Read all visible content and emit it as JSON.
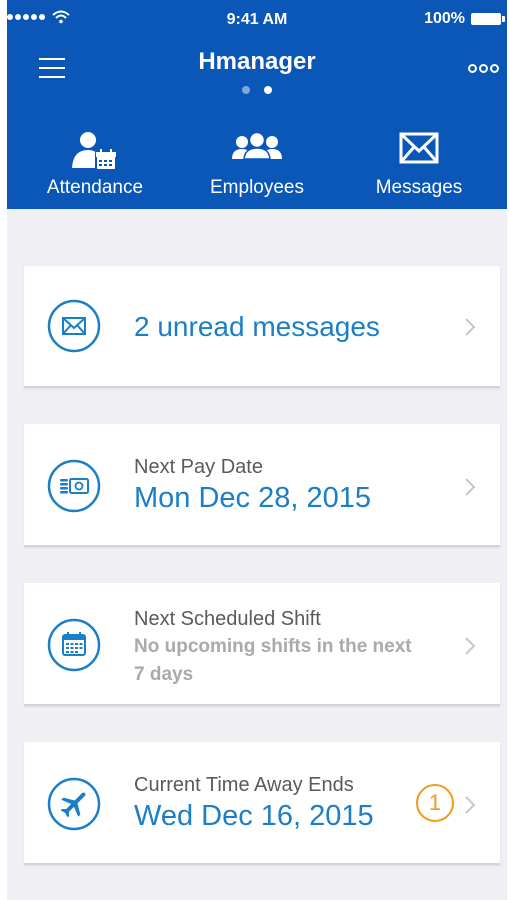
{
  "status_bar": {
    "time": "9:41 AM",
    "battery": "100%",
    "signal_icon": "signal-dots-icon",
    "wifi_icon": "wifi-icon"
  },
  "header": {
    "title": "Hmanager",
    "menu_icon": "hamburger-menu-icon",
    "more_icon": "more-options-icon",
    "page_indicator": {
      "pages": 2,
      "active": 2
    }
  },
  "nav": [
    {
      "label": "Attendance",
      "icon": "attendance-icon"
    },
    {
      "label": "Employees",
      "icon": "employees-icon"
    },
    {
      "label": "Messages",
      "icon": "envelope-icon"
    }
  ],
  "cards": {
    "messages": {
      "text": "2 unread messages",
      "icon": "envelope-icon"
    },
    "pay": {
      "label": "Next Pay Date",
      "value": "Mon Dec 28, 2015",
      "icon": "money-icon"
    },
    "shift": {
      "label": "Next Scheduled Shift",
      "value": "No upcoming shifts in the next 7 days",
      "icon": "calendar-icon"
    },
    "time_away": {
      "label": "Current Time Away Ends",
      "value": "Wed Dec 16, 2015",
      "badge": "1",
      "icon": "airplane-icon"
    }
  },
  "colors": {
    "header_bg": "#0a57b8",
    "accent": "#1a7fc7",
    "badge": "#f39a1a",
    "background": "#efeff4"
  }
}
